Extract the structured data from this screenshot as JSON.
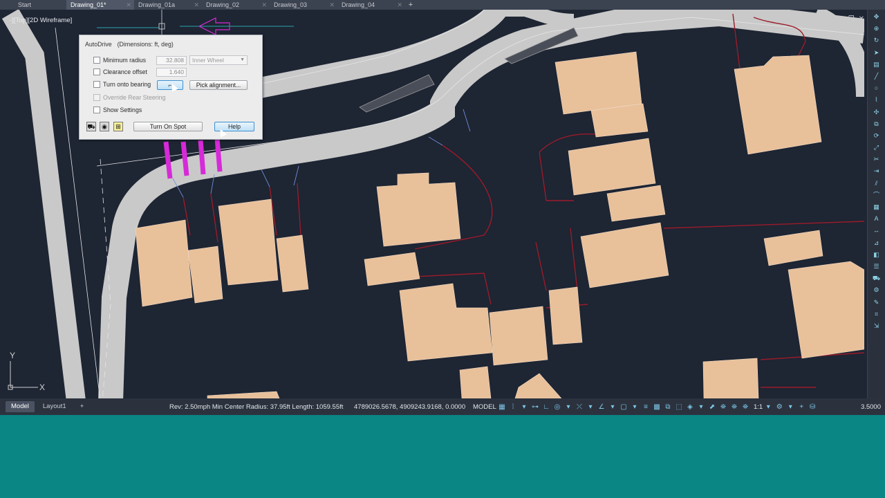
{
  "tabs": [
    {
      "label": "Start"
    },
    {
      "label": "Drawing_01*"
    },
    {
      "label": "Drawing_01a"
    },
    {
      "label": "Drawing_02"
    },
    {
      "label": "Drawing_03"
    },
    {
      "label": "Drawing_04"
    }
  ],
  "new_tab_label": "+",
  "viewport_label": "-][Top][2D Wireframe]",
  "dialog": {
    "title": "AutoDrive",
    "subtitle": "(Dimensions: ft, deg)",
    "min_radius_label": "Minimum radius",
    "min_radius_value": "32.808",
    "min_radius_mode": "Inner Wheel",
    "clearance_label": "Clearance offset",
    "clearance_value": "1.640",
    "bearing_label": "Turn onto bearing",
    "pick_alignment_label": "Pick alignment...",
    "override_rear_label": "Override Rear Steering",
    "show_settings_label": "Show Settings",
    "turn_on_spot_label": "Turn On Spot",
    "help_label": "Help"
  },
  "layout_tabs": [
    {
      "label": "Model"
    },
    {
      "label": "Layout1"
    }
  ],
  "layout_add_label": "+",
  "status": {
    "rev_info": "Rev: 2.50mph Min Center Radius: 37.95ft Length: 1059.55ft",
    "coords": "4789026.5678, 4909243.9168, 0.0000",
    "space": "MODEL",
    "scale": "1:1",
    "annotation_value": "3.5000"
  },
  "ucs": {
    "y_label": "Y",
    "x_label": "X"
  },
  "colors": {
    "background": "#1e2533",
    "road": "#c9c9c9",
    "building": "#e8c09a",
    "property_line": "#9b1b2a",
    "crossing": "#d62ad8",
    "ucs": "#d0d0d0",
    "below_app": "#0a8684"
  }
}
